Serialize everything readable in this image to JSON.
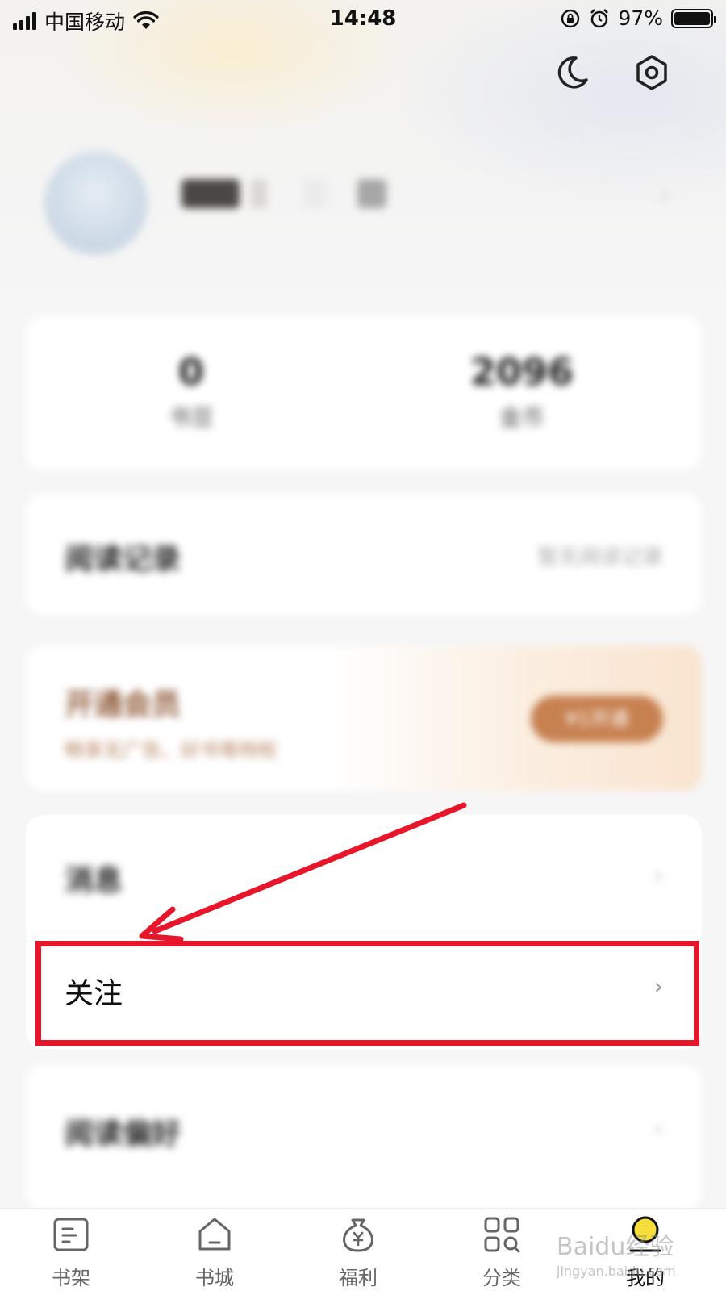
{
  "status_bar": {
    "carrier": "中国移动",
    "time": "14:48",
    "battery": "97%"
  },
  "header": {
    "icons": [
      "moon-icon",
      "settings-hexagon-icon"
    ]
  },
  "stats": [
    {
      "value": "0",
      "label": "书豆"
    },
    {
      "value": "2096",
      "label": "金币"
    }
  ],
  "menu": {
    "history_label": "阅读记录",
    "history_hint": "暂无阅读记录",
    "vip_title": "开通会员",
    "vip_subtitle": "畅享无广告、好书等特权",
    "vip_button": "¥1开通",
    "messages_label": "消息",
    "follow_label": "关注",
    "preferences_label": "阅读偏好"
  },
  "tabs": [
    {
      "label": "书架",
      "icon": "bookshelf-icon",
      "active": false
    },
    {
      "label": "书城",
      "icon": "bookstore-home-icon",
      "active": false
    },
    {
      "label": "福利",
      "icon": "welfare-money-bag-icon",
      "active": false
    },
    {
      "label": "分类",
      "icon": "category-grid-icon",
      "active": false
    },
    {
      "label": "我的",
      "icon": "profile-icon",
      "active": true
    }
  ],
  "watermark": {
    "text": "Baidu经验",
    "sub": "jingyan.baidu.com"
  },
  "colors": {
    "highlight": "#e8162a",
    "vip_accent": "#c78151"
  }
}
